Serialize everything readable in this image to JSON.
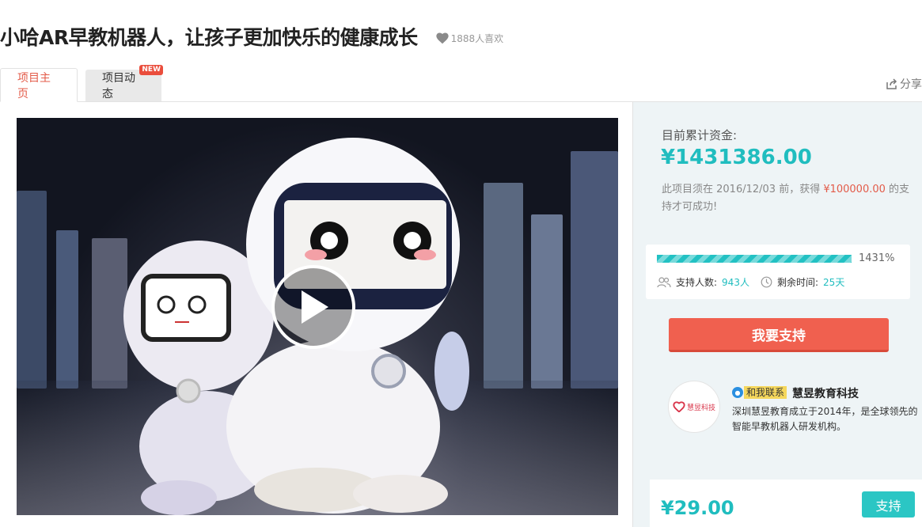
{
  "header": {
    "title": "小哈AR早教机器人，让孩子更加快乐的健康成长",
    "likes": "1888人喜欢"
  },
  "tabs": [
    {
      "label": "项目主页",
      "active": true
    },
    {
      "label": "项目动态",
      "active": false,
      "badge": "NEW"
    }
  ],
  "share_label": "分享",
  "funding": {
    "raised_label": "目前累计资金:",
    "raised_amount": "¥1431386.00",
    "goal_prefix": "此项目须在 2016/12/03 前，获得 ",
    "goal_amount": "¥100000.00",
    "goal_suffix": " 的支持才可成功!",
    "progress_percent_text": "1431%",
    "progress_fraction": 1.0,
    "supporters_label": "支持人数:",
    "supporters_value": "943人",
    "time_label": "剩余时间:",
    "time_value": "25天",
    "support_button": "我要支持"
  },
  "organization": {
    "logo_text": "慧昱科技",
    "contact_tag": "和我联系",
    "name": "慧昱教育科技",
    "description": "深圳慧昱教育成立于2014年，是全球领先的智能早教机器人研发机构。"
  },
  "reward": {
    "price": "¥29.00",
    "button": "支持"
  },
  "colors": {
    "accent_teal": "#20bdbf",
    "accent_red": "#f0604f",
    "sidebar_bg": "#eef4f6"
  },
  "icons": {
    "like": "heart-icon",
    "share": "share-icon",
    "play": "play-icon",
    "supporters": "users-icon",
    "time": "clock-icon",
    "contact": "qq-icon"
  }
}
